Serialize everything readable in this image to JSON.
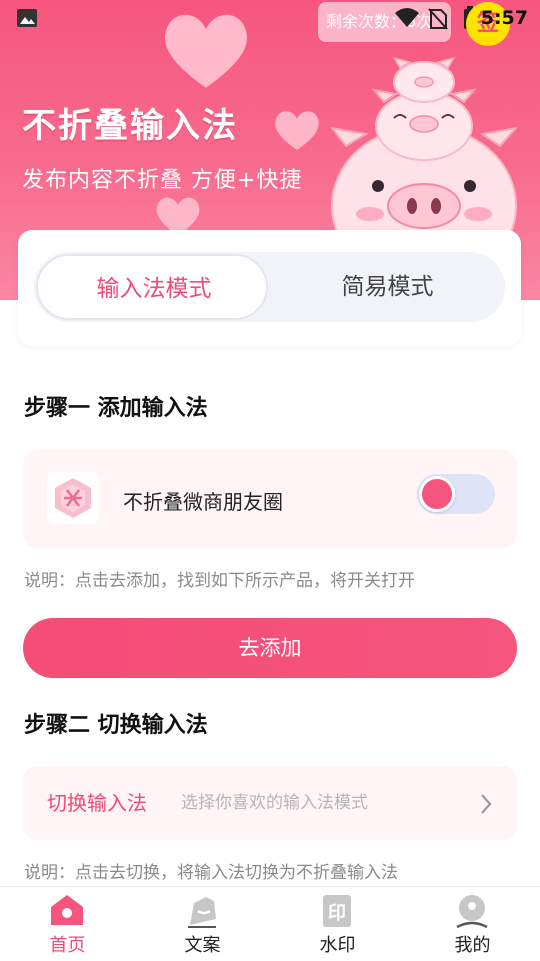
{
  "status_bar": {
    "time": "5:57",
    "icons": [
      "photo-icon",
      "wifi-icon",
      "no-sim-icon",
      "battery-charging-icon"
    ]
  },
  "banner": {
    "title": "不折叠输入法",
    "subtitle": "发布内容不折叠 方便+快捷",
    "remaining": "剩余次数：6次",
    "sign_in": "签"
  },
  "mode_switch": {
    "active": "输入法模式",
    "simple": "简易模式"
  },
  "step1": {
    "title": "步骤一  添加输入法",
    "app_name": "不折叠微商朋友圈",
    "toggle_on": true,
    "note": "说明：点击去添加，找到如下所示产品，将开关打开",
    "button": "去添加"
  },
  "step2": {
    "title": "步骤二  切换输入法",
    "row_label": "切换输入法",
    "row_hint": "选择你喜欢的输入法模式",
    "note": "说明：点击去切换，将输入法切换为不折叠输入法"
  },
  "tabbar": [
    {
      "label": "首页",
      "icon": "home-icon",
      "active": true
    },
    {
      "label": "文案",
      "icon": "copywriting-icon",
      "active": false
    },
    {
      "label": "水印",
      "icon": "watermark-icon",
      "active": false
    },
    {
      "label": "我的",
      "icon": "profile-icon",
      "active": false
    }
  ],
  "colors": {
    "brand": "#f34d78",
    "active_tab": "#f04a77",
    "banner": "#f6567f"
  }
}
